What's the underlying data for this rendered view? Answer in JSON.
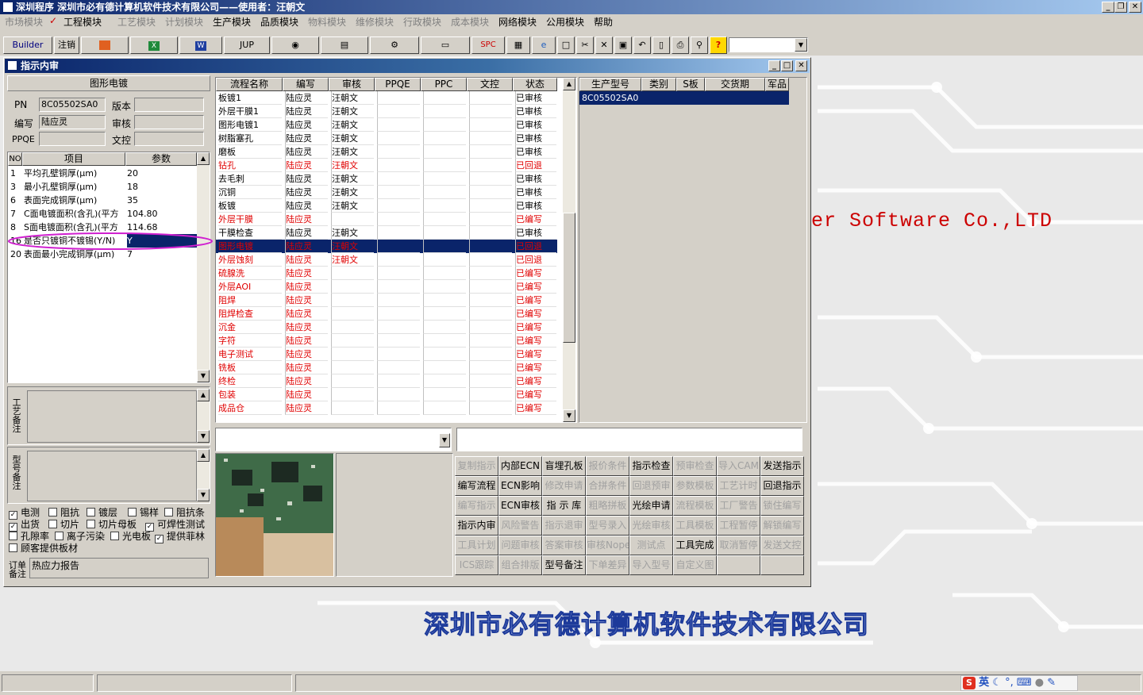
{
  "app": {
    "title": "深圳程序  深圳市必有德计算机软件技术有限公司——使用者：汪朝文"
  },
  "menu": [
    "市场模块",
    "工程模块",
    "工艺模块",
    "计划模块",
    "生产模块",
    "品质模块",
    "物料模块",
    "维修模块",
    "行政模块",
    "成本模块",
    "网络模块",
    "公用模块",
    "帮助"
  ],
  "menu_disabled": [
    true,
    false,
    true,
    true,
    false,
    false,
    true,
    true,
    true,
    true,
    false,
    false,
    false
  ],
  "toolbar": {
    "builder": "Builder",
    "logout": "注销",
    "jup": "JUP",
    "spc": "SPC",
    "combo_value": ""
  },
  "desktop": {
    "company_en": "er Software Co.,LTD",
    "company_cn": "深圳市必有德计算机软件技术有限公司"
  },
  "window": {
    "title": "指示内审"
  },
  "left": {
    "section_title": "图形电镀",
    "pn_label": "PN",
    "pn_value": "8C05502SA0",
    "version_label": "版本",
    "version_value": "",
    "author_label": "编写",
    "author_value": "陆应灵",
    "review_label": "审核",
    "review_value": "",
    "ppqe_label": "PPQE",
    "ppqe_value": "",
    "doc_label": "文控",
    "doc_value": "",
    "params_headers": [
      "NO",
      "项目",
      "参数"
    ],
    "params": [
      {
        "no": "1",
        "item": "平均孔壁铜厚(μm)",
        "value": "20"
      },
      {
        "no": "3",
        "item": "最小孔壁铜厚(μm)",
        "value": "18"
      },
      {
        "no": "6",
        "item": "表面完成铜厚(μm)",
        "value": "35"
      },
      {
        "no": "7",
        "item": "C面电镀面积(含孔)(平方",
        "value": "104.80"
      },
      {
        "no": "8",
        "item": "S面电镀面积(含孔)(平方",
        "value": "114.68"
      },
      {
        "no": "16",
        "item": "是否只镀铜不镀锡(Y/N)",
        "value": "Y"
      },
      {
        "no": "20",
        "item": "表面最小完成铜厚(μm)",
        "value": "7"
      }
    ],
    "process_note_label": "工艺备注",
    "model_note_label": "型号备注",
    "order_note_label": "订单备注",
    "order_note_value": "热应力报告",
    "checks": [
      {
        "label": "电测",
        "checked": true
      },
      {
        "label": "阻抗",
        "checked": false
      },
      {
        "label": "镀层",
        "checked": false
      },
      {
        "label": "锡样",
        "checked": false
      },
      {
        "label": "阻抗条",
        "checked": false
      },
      {
        "label": "出货",
        "checked": true
      },
      {
        "label": "切片",
        "checked": false
      },
      {
        "label": "切片母板",
        "checked": false
      },
      {
        "label": "可焊性测试",
        "checked": true
      },
      {
        "label": "孔隙率",
        "checked": false
      },
      {
        "label": "离子污染",
        "checked": false
      },
      {
        "label": "光电板",
        "checked": false
      },
      {
        "label": "提供菲林",
        "checked": true
      },
      {
        "label": "顾客提供板材",
        "checked": false
      }
    ]
  },
  "flow": {
    "headers": [
      "流程名称",
      "编写",
      "审核",
      "PPQE",
      "PPC",
      "文控",
      "状态"
    ],
    "rows": [
      {
        "name": "板镀1",
        "author": "陆应灵",
        "reviewer": "汪朝文",
        "ppqe": "",
        "ppc": "",
        "doc": "",
        "status": "已审核",
        "red": false
      },
      {
        "name": "外层干膜1",
        "author": "陆应灵",
        "reviewer": "汪朝文",
        "ppqe": "",
        "ppc": "",
        "doc": "",
        "status": "已审核",
        "red": false
      },
      {
        "name": "图形电镀1",
        "author": "陆应灵",
        "reviewer": "汪朝文",
        "ppqe": "",
        "ppc": "",
        "doc": "",
        "status": "已审核",
        "red": false
      },
      {
        "name": "树脂塞孔",
        "author": "陆应灵",
        "reviewer": "汪朝文",
        "ppqe": "",
        "ppc": "",
        "doc": "",
        "status": "已审核",
        "red": false
      },
      {
        "name": "磨板",
        "author": "陆应灵",
        "reviewer": "汪朝文",
        "ppqe": "",
        "ppc": "",
        "doc": "",
        "status": "已审核",
        "red": false
      },
      {
        "name": "钻孔",
        "author": "陆应灵",
        "reviewer": "汪朝文",
        "ppqe": "",
        "ppc": "",
        "doc": "",
        "status": "已回退",
        "red": true
      },
      {
        "name": "去毛刺",
        "author": "陆应灵",
        "reviewer": "汪朝文",
        "ppqe": "",
        "ppc": "",
        "doc": "",
        "status": "已审核",
        "red": false
      },
      {
        "name": "沉铜",
        "author": "陆应灵",
        "reviewer": "汪朝文",
        "ppqe": "",
        "ppc": "",
        "doc": "",
        "status": "已审核",
        "red": false
      },
      {
        "name": "板镀",
        "author": "陆应灵",
        "reviewer": "汪朝文",
        "ppqe": "",
        "ppc": "",
        "doc": "",
        "status": "已审核",
        "red": false
      },
      {
        "name": "外层干膜",
        "author": "陆应灵",
        "reviewer": "",
        "ppqe": "",
        "ppc": "",
        "doc": "",
        "status": "已编写",
        "red": true
      },
      {
        "name": "干膜检查",
        "author": "陆应灵",
        "reviewer": "汪朝文",
        "ppqe": "",
        "ppc": "",
        "doc": "",
        "status": "已审核",
        "red": false
      },
      {
        "name": "图形电镀",
        "author": "陆应灵",
        "reviewer": "汪朝文",
        "ppqe": "",
        "ppc": "",
        "doc": "",
        "status": "已回退",
        "red": true,
        "selected": true
      },
      {
        "name": "外层蚀刻",
        "author": "陆应灵",
        "reviewer": "汪朝文",
        "ppqe": "",
        "ppc": "",
        "doc": "",
        "status": "已回退",
        "red": true
      },
      {
        "name": "硫腺洗",
        "author": "陆应灵",
        "reviewer": "",
        "ppqe": "",
        "ppc": "",
        "doc": "",
        "status": "已编写",
        "red": true
      },
      {
        "name": "外层AOI",
        "author": "陆应灵",
        "reviewer": "",
        "ppqe": "",
        "ppc": "",
        "doc": "",
        "status": "已编写",
        "red": true
      },
      {
        "name": "阻焊",
        "author": "陆应灵",
        "reviewer": "",
        "ppqe": "",
        "ppc": "",
        "doc": "",
        "status": "已编写",
        "red": true
      },
      {
        "name": "阻焊检查",
        "author": "陆应灵",
        "reviewer": "",
        "ppqe": "",
        "ppc": "",
        "doc": "",
        "status": "已编写",
        "red": true
      },
      {
        "name": "沉金",
        "author": "陆应灵",
        "reviewer": "",
        "ppqe": "",
        "ppc": "",
        "doc": "",
        "status": "已编写",
        "red": true
      },
      {
        "name": "字符",
        "author": "陆应灵",
        "reviewer": "",
        "ppqe": "",
        "ppc": "",
        "doc": "",
        "status": "已编写",
        "red": true
      },
      {
        "name": "电子测试",
        "author": "陆应灵",
        "reviewer": "",
        "ppqe": "",
        "ppc": "",
        "doc": "",
        "status": "已编写",
        "red": true
      },
      {
        "name": "铣板",
        "author": "陆应灵",
        "reviewer": "",
        "ppqe": "",
        "ppc": "",
        "doc": "",
        "status": "已编写",
        "red": true
      },
      {
        "name": "终检",
        "author": "陆应灵",
        "reviewer": "",
        "ppqe": "",
        "ppc": "",
        "doc": "",
        "status": "已编写",
        "red": true
      },
      {
        "name": "包装",
        "author": "陆应灵",
        "reviewer": "",
        "ppqe": "",
        "ppc": "",
        "doc": "",
        "status": "已编写",
        "red": true
      },
      {
        "name": "成品仓",
        "author": "陆应灵",
        "reviewer": "",
        "ppqe": "",
        "ppc": "",
        "doc": "",
        "status": "已编写",
        "red": true
      }
    ]
  },
  "models": {
    "headers": [
      "生产型号",
      "类别",
      "S板",
      "交货期",
      "军品"
    ],
    "rows": [
      {
        "model": "8C05502SA0",
        "type": "",
        "s": "",
        "due": "",
        "mil": ""
      }
    ]
  },
  "actions": [
    [
      {
        "l": "复制指示",
        "d": true
      },
      {
        "l": "内部ECN",
        "d": false
      },
      {
        "l": "盲埋孔板",
        "d": false
      },
      {
        "l": "报价条件",
        "d": true
      },
      {
        "l": "指示检查",
        "d": false
      },
      {
        "l": "预审检查",
        "d": true
      },
      {
        "l": "导入CAM",
        "d": true
      },
      {
        "l": "发送指示",
        "d": false
      }
    ],
    [
      {
        "l": "编写流程",
        "d": false
      },
      {
        "l": "ECN影响",
        "d": false
      },
      {
        "l": "修改申请",
        "d": true
      },
      {
        "l": "合拼条件",
        "d": true
      },
      {
        "l": "回退预审",
        "d": true
      },
      {
        "l": "参数模板",
        "d": true
      },
      {
        "l": "工艺计时",
        "d": true
      },
      {
        "l": "回退指示",
        "d": false
      }
    ],
    [
      {
        "l": "编写指示",
        "d": true
      },
      {
        "l": "ECN审核",
        "d": false
      },
      {
        "l": "指 示 库",
        "d": false
      },
      {
        "l": "粗略拼板",
        "d": true
      },
      {
        "l": "光绘申请",
        "d": false
      },
      {
        "l": "流程模板",
        "d": true
      },
      {
        "l": "工厂警告",
        "d": true
      },
      {
        "l": "锁住编写",
        "d": true
      }
    ],
    [
      {
        "l": "指示内审",
        "d": false
      },
      {
        "l": "风险警告",
        "d": true
      },
      {
        "l": "指示退审",
        "d": true
      },
      {
        "l": "型号录入",
        "d": true
      },
      {
        "l": "光绘审核",
        "d": true
      },
      {
        "l": "工具模板",
        "d": true
      },
      {
        "l": "工程暂停",
        "d": true
      },
      {
        "l": "解锁编写",
        "d": true
      }
    ],
    [
      {
        "l": "工具计划",
        "d": true
      },
      {
        "l": "问题审核",
        "d": true
      },
      {
        "l": "答案审核",
        "d": true
      },
      {
        "l": "审核Nope",
        "d": true
      },
      {
        "l": "测试点",
        "d": true
      },
      {
        "l": "工具完成",
        "d": false
      },
      {
        "l": "取消暂停",
        "d": true
      },
      {
        "l": "发送文控",
        "d": true
      }
    ],
    [
      {
        "l": "ICS跟踪",
        "d": true
      },
      {
        "l": "组合排版",
        "d": true
      },
      {
        "l": "型号备注",
        "d": false
      },
      {
        "l": "下单差异",
        "d": true
      },
      {
        "l": "导入型号",
        "d": true
      },
      {
        "l": "自定义图",
        "d": true
      },
      {
        "l": "",
        "d": true
      },
      {
        "l": "",
        "d": true
      }
    ]
  ],
  "tray": {
    "ime": "英"
  }
}
